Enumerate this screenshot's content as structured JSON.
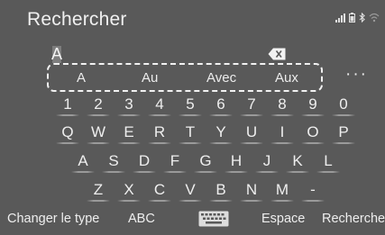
{
  "header": {
    "title": "Rechercher"
  },
  "input": {
    "value": "A"
  },
  "suggestions": [
    "A",
    "Au",
    "Avec",
    "Aux"
  ],
  "more_label": "···",
  "keyboard": {
    "row1": [
      "1",
      "2",
      "3",
      "4",
      "5",
      "6",
      "7",
      "8",
      "9",
      "0"
    ],
    "row2": [
      "Q",
      "W",
      "E",
      "R",
      "T",
      "Y",
      "U",
      "I",
      "O",
      "P"
    ],
    "row3": [
      "A",
      "S",
      "D",
      "F",
      "G",
      "H",
      "J",
      "K",
      "L"
    ],
    "row4": [
      "Z",
      "X",
      "C",
      "V",
      "B",
      "N",
      "M",
      "-"
    ]
  },
  "bottom": {
    "change_type": "Changer le type",
    "abc": "ABC",
    "space": "Espace",
    "search": "Rechercher"
  },
  "icons": [
    "signal-icon",
    "battery-icon",
    "bluetooth-icon",
    "wifi-icon",
    "backspace-icon",
    "keyboard-icon"
  ]
}
